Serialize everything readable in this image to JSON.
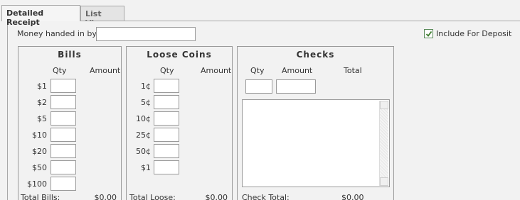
{
  "tabs": [
    {
      "label": "Detailed Receipt",
      "active": true
    },
    {
      "label": "List View",
      "active": false
    }
  ],
  "form": {
    "money_label": "Money handed in by:",
    "money_value": "",
    "include_deposit_label": "Include For Deposit",
    "include_deposit_checked": true
  },
  "bills": {
    "title": "Bills",
    "qty_header": "Qty",
    "amount_header": "Amount",
    "rows": [
      {
        "label": "$1",
        "qty": ""
      },
      {
        "label": "$2",
        "qty": ""
      },
      {
        "label": "$5",
        "qty": ""
      },
      {
        "label": "$10",
        "qty": ""
      },
      {
        "label": "$20",
        "qty": ""
      },
      {
        "label": "$50",
        "qty": ""
      },
      {
        "label": "$100",
        "qty": ""
      }
    ],
    "total_label": "Total Bills:",
    "total_value": "$0.00"
  },
  "coins": {
    "title": "Loose Coins",
    "qty_header": "Qty",
    "amount_header": "Amount",
    "rows": [
      {
        "label": "1¢",
        "qty": ""
      },
      {
        "label": "5¢",
        "qty": ""
      },
      {
        "label": "10¢",
        "qty": ""
      },
      {
        "label": "25¢",
        "qty": ""
      },
      {
        "label": "50¢",
        "qty": ""
      },
      {
        "label": "$1",
        "qty": ""
      }
    ],
    "total_label": "Total Loose:",
    "total_value": "$0.00"
  },
  "checks": {
    "title": "Checks",
    "qty_header": "Qty",
    "amount_header": "Amount",
    "total_header": "Total",
    "qty_value": "",
    "amount_value": "",
    "total_label": "Check Total:",
    "total_value": "$0.00"
  },
  "colors": {
    "check_mark": "#3a7a2a",
    "panel_bg": "#f2f2f2",
    "border": "#9a9a9a"
  }
}
